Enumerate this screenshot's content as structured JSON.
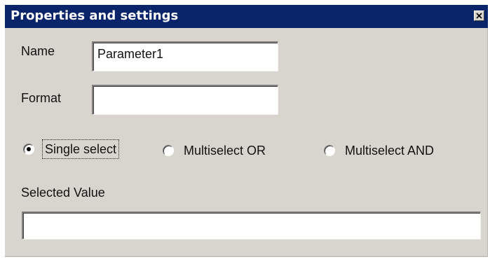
{
  "dialog": {
    "title": "Properties and settings",
    "close_icon": "close-icon"
  },
  "fields": {
    "name_label": "Name",
    "name_value": "Parameter1",
    "format_label": "Format",
    "format_value": ""
  },
  "selection_mode": {
    "options": [
      {
        "label": "Single select",
        "selected": true
      },
      {
        "label": "Multiselect OR",
        "selected": false
      },
      {
        "label": "Multiselect AND",
        "selected": false
      }
    ]
  },
  "selected_value": {
    "label": "Selected Value",
    "value": ""
  }
}
